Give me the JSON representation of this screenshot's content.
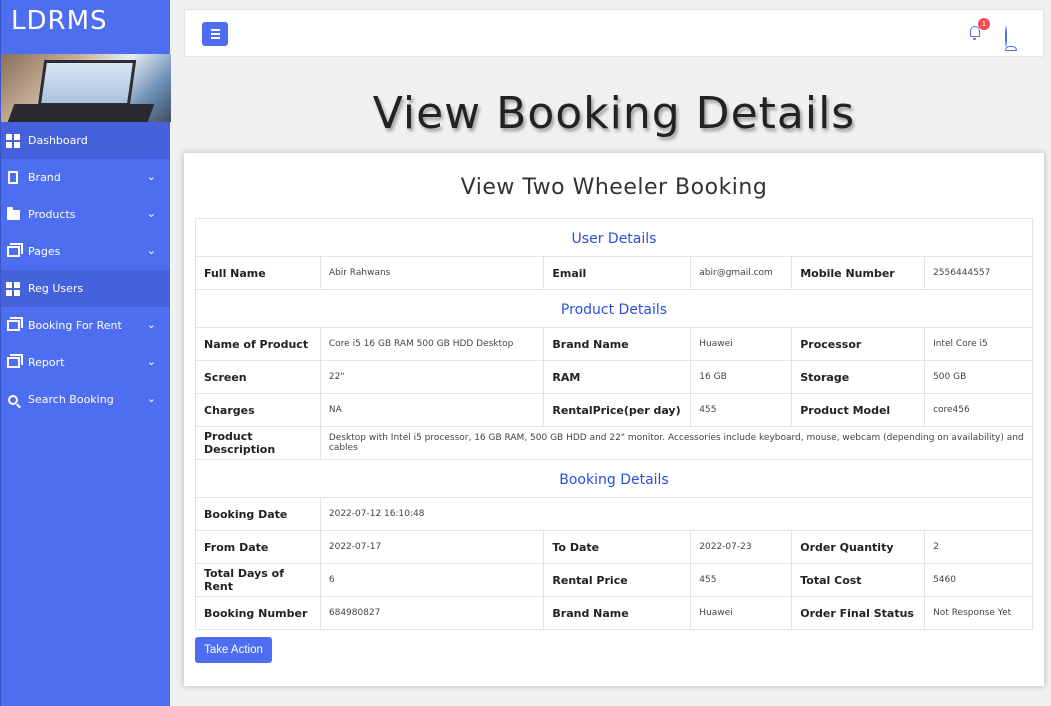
{
  "app": {
    "brand": "LDRMS",
    "page_title": "View Booking Details"
  },
  "sidebar": {
    "items": [
      {
        "label": "Dashboard",
        "icon": "dashboard-icon",
        "active": true,
        "expandable": false
      },
      {
        "label": "Brand",
        "icon": "file-icon",
        "active": false,
        "expandable": true
      },
      {
        "label": "Products",
        "icon": "folder-icon",
        "active": false,
        "expandable": true
      },
      {
        "label": "Pages",
        "icon": "pages-icon",
        "active": false,
        "expandable": true
      },
      {
        "label": "Reg Users",
        "icon": "grid-icon",
        "active": true,
        "expandable": false
      },
      {
        "label": "Booking For Rent",
        "icon": "pages-icon",
        "active": false,
        "expandable": true
      },
      {
        "label": "Report",
        "icon": "pages-icon",
        "active": false,
        "expandable": true
      },
      {
        "label": "Search Booking",
        "icon": "search-icon",
        "active": false,
        "expandable": true
      }
    ]
  },
  "topbar": {
    "notification_count": "1"
  },
  "card": {
    "title": "View Two Wheeler Booking",
    "user_section": "User Details",
    "product_section": "Product Details",
    "booking_section": "Booking Details",
    "user": {
      "full_name_label": "Full Name",
      "full_name": "Abir Rahwans",
      "email_label": "Email",
      "email": "abir@gmail.com",
      "mobile_label": "Mobile Number",
      "mobile": "2556444557"
    },
    "product": {
      "name_label": "Name of Product",
      "name": "Core i5 16 GB RAM 500 GB HDD Desktop",
      "brand_label": "Brand Name",
      "brand": "Huawei",
      "processor_label": "Processor",
      "processor": "Intel Core i5",
      "screen_label": "Screen",
      "screen": "22\"",
      "ram_label": "RAM",
      "ram": "16 GB",
      "storage_label": "Storage",
      "storage": "500 GB",
      "charges_label": "Charges",
      "charges": "NA",
      "rental_label": "RentalPrice(per day)",
      "rental": "455",
      "model_label": "Product Model",
      "model": "core456",
      "desc_label": "Product Description",
      "desc": "Desktop with Intel i5 processor, 16 GB RAM, 500 GB HDD and 22\" monitor. Accessories include keyboard, mouse, webcam (depending on availability) and cables"
    },
    "booking": {
      "date_label": "Booking Date",
      "date": "2022-07-12 16:10:48",
      "from_label": "From Date",
      "from": "2022-07-17",
      "to_label": "To Date",
      "to": "2022-07-23",
      "qty_label": "Order Quantity",
      "qty": "2",
      "days_label": "Total Days of Rent",
      "days": "6",
      "price_label": "Rental Price",
      "price": "455",
      "cost_label": "Total Cost",
      "cost": "5460",
      "number_label": "Booking Number",
      "number": "684980827",
      "brand_label": "Brand Name",
      "brand": "Huawei",
      "status_label": "Order Final Status",
      "status": "Not Response Yet"
    },
    "action_button": "Take Action"
  },
  "colors": {
    "accent": "#4e6ef2",
    "section_heading": "#2a4fe0",
    "badge": "#f04e4e"
  }
}
